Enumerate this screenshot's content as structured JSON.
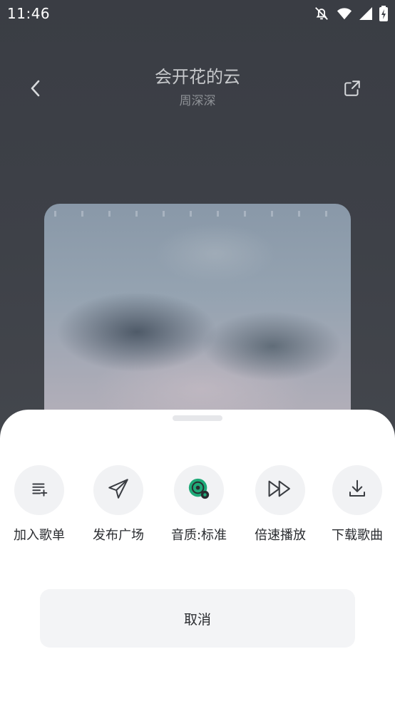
{
  "status_bar": {
    "time": "11:46",
    "icons": [
      "notifications-off-icon",
      "wifi-icon",
      "cellular-signal-icon",
      "battery-charging-icon"
    ]
  },
  "header": {
    "title": "会开花的云",
    "artist": "周深深",
    "back_icon": "chevron-left-icon",
    "share_icon": "share-external-icon"
  },
  "action_sheet": {
    "actions": [
      {
        "label": "加入歌单",
        "icon": "playlist-add-icon"
      },
      {
        "label": "发布广场",
        "icon": "paper-plane-icon"
      },
      {
        "label": "音质:标准",
        "icon": "audio-quality-disc-icon",
        "accent": "#1faa78"
      },
      {
        "label": "倍速播放",
        "icon": "fast-forward-icon"
      },
      {
        "label": "下载歌曲",
        "icon": "download-icon"
      }
    ],
    "cancel_label": "取消"
  },
  "colors": {
    "background_top": "#3a3d44",
    "sheet": "#ffffff",
    "action_circle": "#f1f2f4",
    "accent_green": "#1faa78"
  }
}
